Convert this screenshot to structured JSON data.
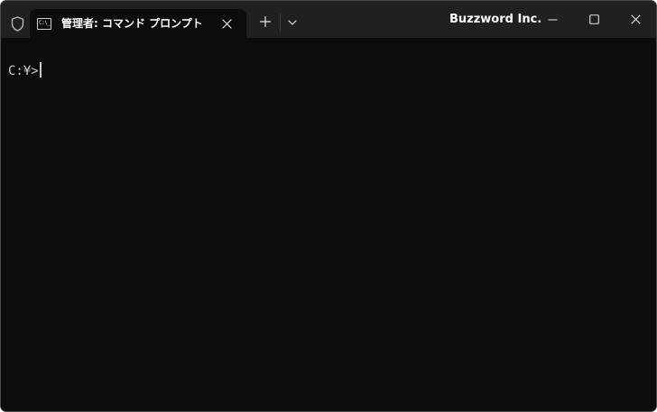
{
  "titlebar": {
    "tab": {
      "icon": "command-prompt-icon",
      "icon_text": "C:\\_",
      "title": "管理者: コマンド プロンプト"
    },
    "brand": "Buzzword Inc.",
    "icons": {
      "shield": "shield-icon",
      "close_tab": "close-icon",
      "new_tab": "plus-icon",
      "dropdown": "chevron-down-icon",
      "minimize": "minimize-icon",
      "maximize": "maximize-icon",
      "close_window": "close-icon"
    }
  },
  "console": {
    "prompt": "C:¥>"
  },
  "colors": {
    "titlebar_bg": "#202020",
    "console_bg": "#0c0c0c",
    "console_text": "#cccccc",
    "title_text": "#ffffff"
  }
}
